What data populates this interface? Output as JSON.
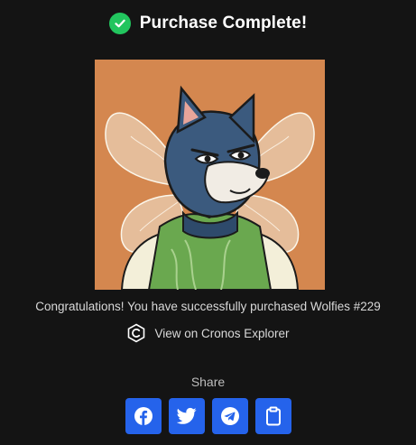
{
  "header": {
    "title": "Purchase Complete!",
    "status_icon": "check-circle-icon",
    "status_color": "#22c55e"
  },
  "nft": {
    "image_description": "Cartoon blue wolf character with fairy wings wearing a green leaf-pattern vest on an orange background",
    "background_color": "#d4874f"
  },
  "message": {
    "congrats_text": "Congratulations! You have successfully purchased Wolfies #229"
  },
  "explorer": {
    "link_text": "View on Cronos Explorer",
    "icon": "cronos-logo-icon"
  },
  "share": {
    "label": "Share",
    "button_color": "#2563eb",
    "buttons": [
      {
        "name": "facebook",
        "icon": "facebook-icon"
      },
      {
        "name": "twitter",
        "icon": "twitter-icon"
      },
      {
        "name": "telegram",
        "icon": "telegram-icon"
      },
      {
        "name": "copy",
        "icon": "clipboard-icon"
      }
    ]
  }
}
